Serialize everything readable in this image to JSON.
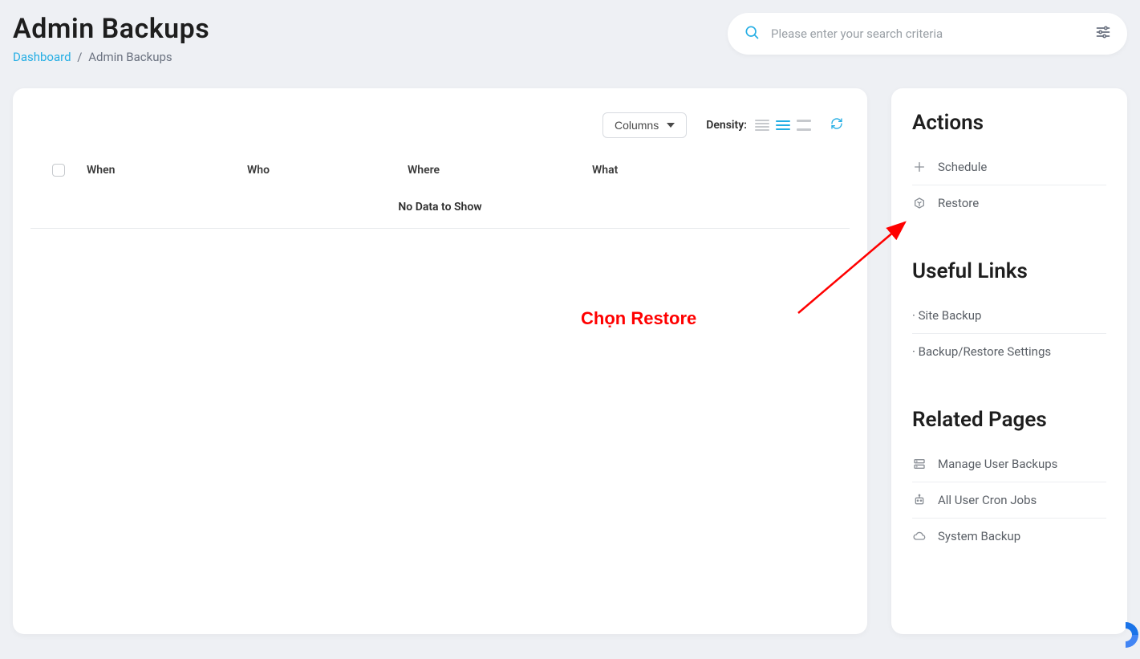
{
  "header": {
    "title": "Admin Backups",
    "breadcrumb": {
      "home": "Dashboard",
      "current": "Admin Backups"
    }
  },
  "search": {
    "placeholder": "Please enter your search criteria"
  },
  "table": {
    "columns_button": "Columns",
    "density_label": "Density:",
    "headers": {
      "when": "When",
      "who": "Who",
      "where": "Where",
      "what": "What"
    },
    "empty_text": "No Data to Show"
  },
  "sidebar": {
    "actions": {
      "title": "Actions",
      "items": [
        {
          "label": "Schedule"
        },
        {
          "label": "Restore"
        }
      ]
    },
    "useful_links": {
      "title": "Useful Links",
      "items": [
        {
          "label": "Site Backup"
        },
        {
          "label": "Backup/Restore Settings"
        }
      ]
    },
    "related_pages": {
      "title": "Related Pages",
      "items": [
        {
          "label": "Manage User Backups"
        },
        {
          "label": "All User Cron Jobs"
        },
        {
          "label": "System Backup"
        }
      ]
    }
  },
  "annotation": {
    "text": "Chọn Restore"
  }
}
